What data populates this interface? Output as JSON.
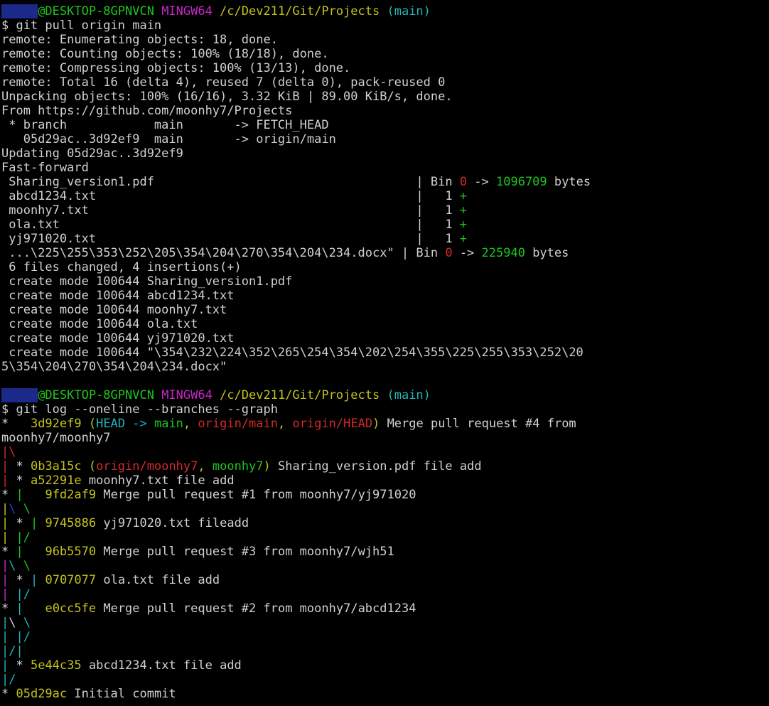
{
  "terminal": {
    "lines": [
      [
        [
          "redact",
          "     "
        ],
        [
          "g",
          "@DESKTOP-8GPNVCN "
        ],
        [
          "m",
          "MINGW64 "
        ],
        [
          "y",
          "/c/Dev211/Git/Projects "
        ],
        [
          "c",
          "(main)"
        ]
      ],
      [
        [
          "w",
          "$ git pull origin main"
        ]
      ],
      [
        [
          "w",
          "remote: Enumerating objects: 18, done."
        ]
      ],
      [
        [
          "w",
          "remote: Counting objects: 100% (18/18), done."
        ]
      ],
      [
        [
          "w",
          "remote: Compressing objects: 100% (13/13), done."
        ]
      ],
      [
        [
          "w",
          "remote: Total 16 (delta 4), reused 7 (delta 0), pack-reused 0"
        ]
      ],
      [
        [
          "w",
          "Unpacking objects: 100% (16/16), 3.32 KiB | 89.00 KiB/s, done."
        ]
      ],
      [
        [
          "w",
          "From https://github.com/moonhy7/Projects"
        ]
      ],
      [
        [
          "w",
          " * branch            main       -> FETCH_HEAD"
        ]
      ],
      [
        [
          "w",
          "   05d29ac..3d92ef9  main       -> origin/main"
        ]
      ],
      [
        [
          "w",
          "Updating 05d29ac..3d92ef9"
        ]
      ],
      [
        [
          "w",
          "Fast-forward"
        ]
      ],
      [
        [
          "w",
          " Sharing_version1.pdf                                    | Bin "
        ],
        [
          "r",
          "0"
        ],
        [
          "w",
          " -> "
        ],
        [
          "g",
          "1096709"
        ],
        [
          "w",
          " bytes"
        ]
      ],
      [
        [
          "w",
          " abcd1234.txt                                            |   1 "
        ],
        [
          "g",
          "+"
        ]
      ],
      [
        [
          "w",
          " moonhy7.txt                                             |   1 "
        ],
        [
          "g",
          "+"
        ]
      ],
      [
        [
          "w",
          " ola.txt                                                 |   1 "
        ],
        [
          "g",
          "+"
        ]
      ],
      [
        [
          "w",
          " yj971020.txt                                            |   1 "
        ],
        [
          "g",
          "+"
        ]
      ],
      [
        [
          "w",
          " ...\\225\\255\\353\\252\\205\\354\\204\\270\\354\\204\\234.docx\" | Bin "
        ],
        [
          "r",
          "0"
        ],
        [
          "w",
          " -> "
        ],
        [
          "g",
          "225940"
        ],
        [
          "w",
          " bytes"
        ]
      ],
      [
        [
          "w",
          " 6 files changed, 4 insertions(+)"
        ]
      ],
      [
        [
          "w",
          " create mode 100644 Sharing_version1.pdf"
        ]
      ],
      [
        [
          "w",
          " create mode 100644 abcd1234.txt"
        ]
      ],
      [
        [
          "w",
          " create mode 100644 moonhy7.txt"
        ]
      ],
      [
        [
          "w",
          " create mode 100644 ola.txt"
        ]
      ],
      [
        [
          "w",
          " create mode 100644 yj971020.txt"
        ]
      ],
      [
        [
          "w",
          " create mode 100644 \"\\354\\232\\224\\352\\265\\254\\354\\202\\254\\355\\225\\255\\353\\252\\20"
        ]
      ],
      [
        [
          "w",
          "5\\354\\204\\270\\354\\204\\234.docx\""
        ]
      ],
      [
        [
          "w",
          ""
        ]
      ],
      [
        [
          "redact",
          "     "
        ],
        [
          "g",
          "@DESKTOP-8GPNVCN "
        ],
        [
          "m",
          "MINGW64 "
        ],
        [
          "y",
          "/c/Dev211/Git/Projects "
        ],
        [
          "c",
          "(main)"
        ]
      ],
      [
        [
          "w",
          "$ git log --oneline --branches --graph"
        ]
      ],
      [
        [
          "w",
          "*   "
        ],
        [
          "y",
          "3d92ef9 ("
        ],
        [
          "c",
          "HEAD -> "
        ],
        [
          "g",
          "main"
        ],
        [
          "y",
          ", "
        ],
        [
          "r",
          "origin/main"
        ],
        [
          "y",
          ", "
        ],
        [
          "r",
          "origin/HEAD"
        ],
        [
          "y",
          ")"
        ],
        [
          "w",
          " Merge pull request #4 from"
        ]
      ],
      [
        [
          "w",
          "moonhy7/moonhy7"
        ]
      ],
      [
        [
          "r",
          "|\\"
        ]
      ],
      [
        [
          "r",
          "|"
        ],
        [
          "w",
          " * "
        ],
        [
          "y",
          "0b3a15c ("
        ],
        [
          "r",
          "origin/moonhy7"
        ],
        [
          "y",
          ", "
        ],
        [
          "g",
          "moonhy7"
        ],
        [
          "y",
          ")"
        ],
        [
          "w",
          " Sharing_version.pdf file add"
        ]
      ],
      [
        [
          "r",
          "|"
        ],
        [
          "w",
          " * "
        ],
        [
          "y",
          "a52291e"
        ],
        [
          "w",
          " moonhy7.txt file add"
        ]
      ],
      [
        [
          "w",
          "* "
        ],
        [
          "g",
          "|"
        ],
        [
          "w",
          "   "
        ],
        [
          "y",
          "9fd2af9"
        ],
        [
          "w",
          " Merge pull request #1 from moonhy7/yj971020"
        ]
      ],
      [
        [
          "y",
          "|"
        ],
        [
          "b",
          "\\"
        ],
        [
          "w",
          " "
        ],
        [
          "g",
          "\\"
        ]
      ],
      [
        [
          "y",
          "|"
        ],
        [
          "w",
          " * "
        ],
        [
          "g",
          "|"
        ],
        [
          "w",
          " "
        ],
        [
          "y",
          "9745886"
        ],
        [
          "w",
          " yj971020.txt fileadd"
        ]
      ],
      [
        [
          "y",
          "|"
        ],
        [
          "w",
          " "
        ],
        [
          "g",
          "|/"
        ]
      ],
      [
        [
          "w",
          "* "
        ],
        [
          "g",
          "|"
        ],
        [
          "w",
          "   "
        ],
        [
          "y",
          "96b5570"
        ],
        [
          "w",
          " Merge pull request #3 from moonhy7/wjh51"
        ]
      ],
      [
        [
          "m",
          "|"
        ],
        [
          "c",
          "\\"
        ],
        [
          "w",
          " "
        ],
        [
          "g",
          "\\"
        ]
      ],
      [
        [
          "m",
          "|"
        ],
        [
          "w",
          " * "
        ],
        [
          "c",
          "|"
        ],
        [
          "w",
          " "
        ],
        [
          "y",
          "0707077"
        ],
        [
          "w",
          " ola.txt file add"
        ]
      ],
      [
        [
          "m",
          "|"
        ],
        [
          "w",
          " "
        ],
        [
          "c",
          "|/"
        ]
      ],
      [
        [
          "w",
          "* "
        ],
        [
          "c",
          "|"
        ],
        [
          "w",
          "   "
        ],
        [
          "y",
          "e0cc5fe"
        ],
        [
          "w",
          " Merge pull request #2 from moonhy7/abcd1234"
        ]
      ],
      [
        [
          "c",
          "|"
        ],
        [
          "w",
          "\\ "
        ],
        [
          "c",
          "\\"
        ]
      ],
      [
        [
          "c",
          "|"
        ],
        [
          "w",
          " "
        ],
        [
          "c",
          "|/"
        ]
      ],
      [
        [
          "c",
          "|/|"
        ]
      ],
      [
        [
          "c",
          "|"
        ],
        [
          "w",
          " * "
        ],
        [
          "y",
          "5e44c35"
        ],
        [
          "w",
          " abcd1234.txt file add"
        ]
      ],
      [
        [
          "c",
          "|/"
        ]
      ],
      [
        [
          "w",
          "* "
        ],
        [
          "y",
          "05d29ac"
        ],
        [
          "w",
          " Initial commit"
        ]
      ]
    ]
  }
}
